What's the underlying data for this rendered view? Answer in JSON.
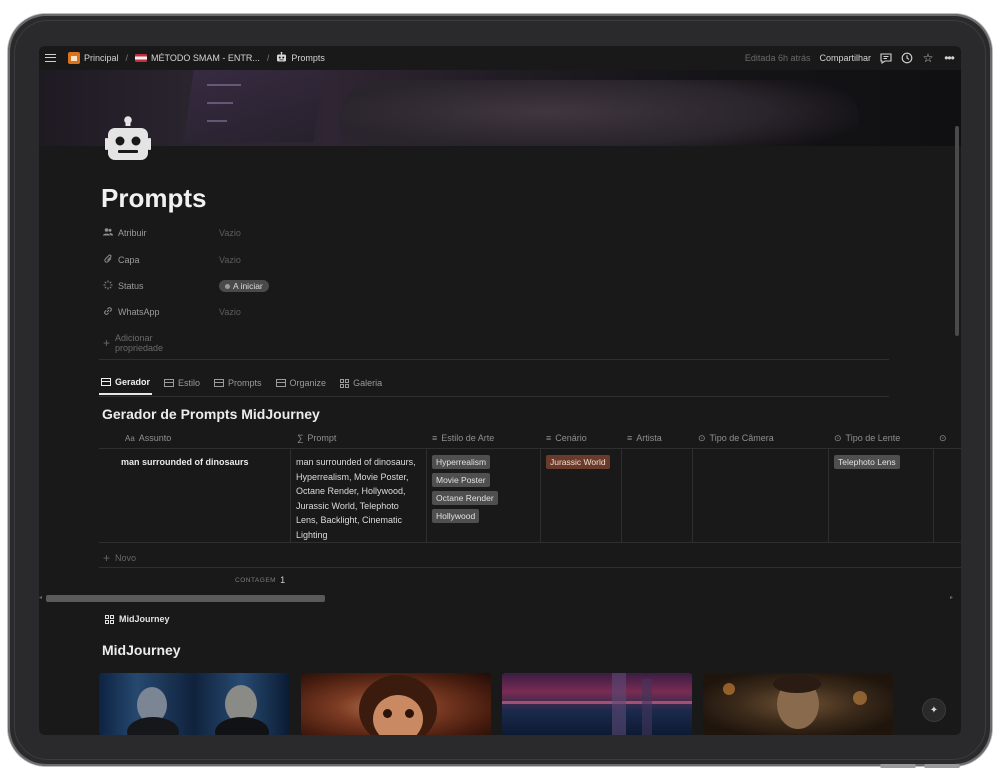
{
  "breadcrumb": {
    "items": [
      {
        "label": "Principal"
      },
      {
        "label": "MÉTODO SMAM - ENTR..."
      },
      {
        "label": "Prompts"
      }
    ]
  },
  "topbar": {
    "edited": "Editada 6h atrás",
    "share": "Compartilhar"
  },
  "page": {
    "title": "Prompts"
  },
  "properties": [
    {
      "label": "Atribuir",
      "value": "Vazio",
      "icon": "people-icon"
    },
    {
      "label": "Capa",
      "value": "Vazio",
      "icon": "paperclip-icon"
    },
    {
      "label": "Status",
      "value": "A iniciar",
      "icon": "status-icon"
    },
    {
      "label": "WhatsApp",
      "value": "Vazio",
      "icon": "link-icon"
    }
  ],
  "add_property": "Adicionar propriedade",
  "tabs": [
    {
      "label": "Gerador",
      "active": true
    },
    {
      "label": "Estilo"
    },
    {
      "label": "Prompts"
    },
    {
      "label": "Organize"
    },
    {
      "label": "Galeria"
    }
  ],
  "database": {
    "title": "Gerador de Prompts MidJourney",
    "columns": [
      {
        "prefix": "Aa",
        "label": "Assunto"
      },
      {
        "prefix": "∑",
        "label": "Prompt"
      },
      {
        "prefix": "≡",
        "label": "Estilo de Arte"
      },
      {
        "prefix": "≡",
        "label": "Cenário"
      },
      {
        "prefix": "≡",
        "label": "Artista"
      },
      {
        "prefix": "⊙",
        "label": "Tipo de Câmera"
      },
      {
        "prefix": "⊙",
        "label": "Tipo de Lente"
      },
      {
        "prefix": "⊙",
        "label": ""
      }
    ],
    "rows": [
      {
        "assunto": "man surrounded of dinosaurs",
        "prompt": "man surrounded of dinosaurs, Hyperrealism, Movie Poster, Octane Render, Hollywood, Jurassic World, Telephoto Lens, Backlight, Cinematic Lighting",
        "estilo": [
          "Hyperrealism",
          "Movie Poster",
          "Octane Render",
          "Hollywood"
        ],
        "cenario": [
          "Jurassic World"
        ],
        "artista": [],
        "camera": "",
        "lente": [
          "Telephoto Lens"
        ]
      }
    ],
    "new_label": "Novo",
    "count_label": "CONTAGEM",
    "count_value": "1"
  },
  "gallery": {
    "view_label": "MidJourney",
    "title": "MidJourney"
  },
  "colors": {
    "background": "#191919",
    "tag_default": "#4f4f4f",
    "tag_brown": "#6a3b2a"
  }
}
